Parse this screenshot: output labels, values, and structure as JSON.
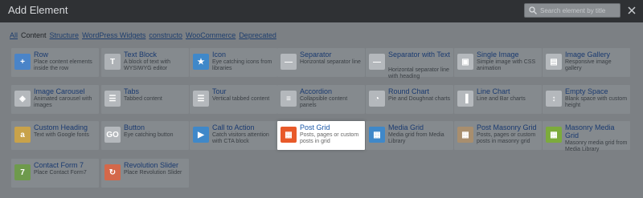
{
  "window": {
    "title": "Add Element",
    "search_placeholder": "Search element by title"
  },
  "tabs": [
    "All",
    "Content",
    "Structure",
    "WordPress Widgets",
    "constructo",
    "WooCommerce",
    "Deprecated"
  ],
  "active_tab": "Content",
  "elements": [
    {
      "name": "Row",
      "desc": "Place content elements inside the row",
      "icon": "row-icon",
      "color": "#4a84c8",
      "highlight": false
    },
    {
      "name": "Text Block",
      "desc": "A block of text with WYSIWYG editor",
      "icon": "text-block-icon",
      "color": "#aeb2b6",
      "highlight": false
    },
    {
      "name": "Icon",
      "desc": "Eye catching icons from libraries",
      "icon": "icon-icon",
      "color": "#3f88c9",
      "highlight": false
    },
    {
      "name": "Separator",
      "desc": "Horizontal separator line",
      "icon": "separator-icon",
      "color": "#b4b8bc",
      "highlight": false
    },
    {
      "name": "Separator with Text",
      "desc": "Horizontal separator line with heading",
      "icon": "separator-with-text-icon",
      "color": "#b4b8bc",
      "highlight": false
    },
    {
      "name": "Single Image",
      "desc": "Simple image with CSS animation",
      "icon": "single-image-icon",
      "color": "#b4b8bc",
      "highlight": false
    },
    {
      "name": "Image Gallery",
      "desc": "Responsive image gallery",
      "icon": "image-gallery-icon",
      "color": "#b4b8bc",
      "highlight": false
    },
    {
      "name": "Image Carousel",
      "desc": "Animated carousel with images",
      "icon": "image-carousel-icon",
      "color": "#b4b8bc",
      "highlight": false
    },
    {
      "name": "Tabs",
      "desc": "Tabbed content",
      "icon": "tabs-icon",
      "color": "#b4b8bc",
      "highlight": false
    },
    {
      "name": "Tour",
      "desc": "Vertical tabbed content",
      "icon": "tour-icon",
      "color": "#b4b8bc",
      "highlight": false
    },
    {
      "name": "Accordion",
      "desc": "Collapsible content panels",
      "icon": "accordion-icon",
      "color": "#b4b8bc",
      "highlight": false
    },
    {
      "name": "Round Chart",
      "desc": "Pie and Doughnat charts",
      "icon": "round-chart-icon",
      "color": "#b4b8bc",
      "highlight": false
    },
    {
      "name": "Line Chart",
      "desc": "Line and Bar charts",
      "icon": "line-chart-icon",
      "color": "#b4b8bc",
      "highlight": false
    },
    {
      "name": "Empty Space",
      "desc": "Blank space with custom height",
      "icon": "empty-space-icon",
      "color": "#b4b8bc",
      "highlight": false
    },
    {
      "name": "Custom Heading",
      "desc": "Text with Google fonts",
      "icon": "custom-heading-icon",
      "color": "#c8a24a",
      "highlight": false
    },
    {
      "name": "Button",
      "desc": "Eye catching button",
      "icon": "button-icon",
      "color": "#b4b8bc",
      "highlight": false
    },
    {
      "name": "Call to Action",
      "desc": "Catch visitors attention with CTA block",
      "icon": "call-to-action-icon",
      "color": "#3f88c9",
      "highlight": false
    },
    {
      "name": "Post Grid",
      "desc": "Posts, pages or custom posts in grid",
      "icon": "post-grid-icon",
      "color": "#e85a2a",
      "highlight": true
    },
    {
      "name": "Media Grid",
      "desc": "Media grid from Media Library",
      "icon": "media-grid-icon",
      "color": "#3f88c9",
      "highlight": false
    },
    {
      "name": "Post Masonry Grid",
      "desc": "Posts, pages or custom posts in masonry grid",
      "icon": "post-masonry-grid-icon",
      "color": "#a88e6e",
      "highlight": false
    },
    {
      "name": "Masonry Media Grid",
      "desc": "Masonry media grid from Media Library",
      "icon": "masonry-media-grid-icon",
      "color": "#7cab3c",
      "highlight": false
    },
    {
      "name": "Contact Form 7",
      "desc": "Place Contact Form7",
      "icon": "contact-form-7-icon",
      "color": "#6e9a4c",
      "highlight": false
    },
    {
      "name": "Revolution Slider",
      "desc": "Place Revolution Slider",
      "icon": "revolution-slider-icon",
      "color": "#d4684a",
      "highlight": false
    }
  ]
}
